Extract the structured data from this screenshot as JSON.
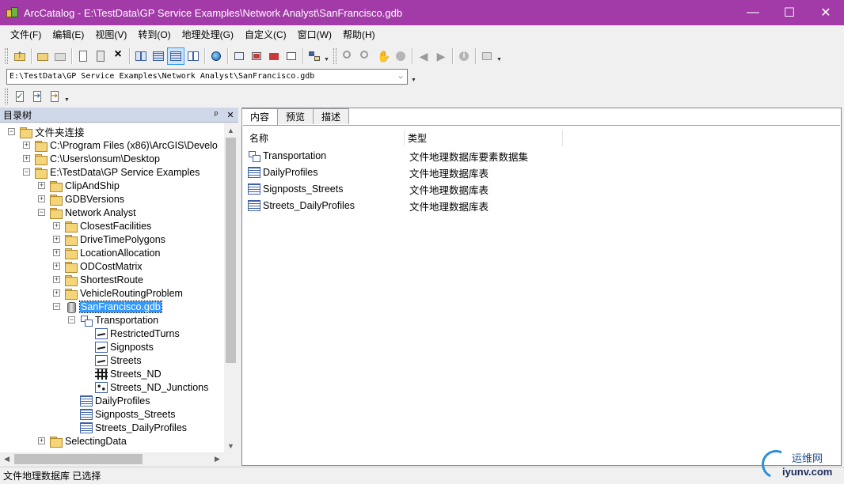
{
  "window": {
    "title": "ArcCatalog - E:\\TestData\\GP Service Examples\\Network Analyst\\SanFrancisco.gdb",
    "minimize": "—",
    "maximize": "☐",
    "close": "✕"
  },
  "menu": [
    "文件(F)",
    "编辑(E)",
    "视图(V)",
    "转到(O)",
    "地理处理(G)",
    "自定义(C)",
    "窗口(W)",
    "帮助(H)"
  ],
  "address": {
    "value": "E:\\TestData\\GP Service Examples\\Network Analyst\\SanFrancisco.gdb"
  },
  "tree_panel": {
    "title": "目录树",
    "pin": "ᵖ",
    "close": "✕",
    "nodes": [
      {
        "label": "文件夹连接",
        "icon": "folder",
        "expander": "−"
      },
      {
        "label": "C:\\Program Files (x86)\\ArcGIS\\Develo",
        "icon": "folder",
        "expander": "+"
      },
      {
        "label": "C:\\Users\\onsum\\Desktop",
        "icon": "folder",
        "expander": "+"
      },
      {
        "label": "E:\\TestData\\GP Service Examples",
        "icon": "folder",
        "expander": "−"
      },
      {
        "label": "ClipAndShip",
        "icon": "folder",
        "expander": "+"
      },
      {
        "label": "GDBVersions",
        "icon": "folder",
        "expander": "+"
      },
      {
        "label": "Network Analyst",
        "icon": "folder",
        "expander": "−"
      },
      {
        "label": "ClosestFacilities",
        "icon": "folder",
        "expander": "+"
      },
      {
        "label": "DriveTimePolygons",
        "icon": "folder",
        "expander": "+"
      },
      {
        "label": "LocationAllocation",
        "icon": "folder",
        "expander": "+"
      },
      {
        "label": "ODCostMatrix",
        "icon": "folder",
        "expander": "+"
      },
      {
        "label": "ShortestRoute",
        "icon": "folder",
        "expander": "+"
      },
      {
        "label": "VehicleRoutingProblem",
        "icon": "folder",
        "expander": "+"
      },
      {
        "label": "SanFrancisco.gdb",
        "icon": "gdb",
        "expander": "−"
      },
      {
        "label": "Transportation",
        "icon": "feature-dataset",
        "expander": "−"
      },
      {
        "label": "RestrictedTurns",
        "icon": "line-feature-class",
        "expander": ""
      },
      {
        "label": "Signposts",
        "icon": "line-feature-class",
        "expander": ""
      },
      {
        "label": "Streets",
        "icon": "line-feature-class",
        "expander": ""
      },
      {
        "label": "Streets_ND",
        "icon": "network-dataset",
        "expander": ""
      },
      {
        "label": "Streets_ND_Junctions",
        "icon": "point-feature-class",
        "expander": ""
      },
      {
        "label": "DailyProfiles",
        "icon": "table",
        "expander": ""
      },
      {
        "label": "Signposts_Streets",
        "icon": "table",
        "expander": ""
      },
      {
        "label": "Streets_DailyProfiles",
        "icon": "table",
        "expander": ""
      },
      {
        "label": "SelectingData",
        "icon": "folder",
        "expander": "+"
      }
    ]
  },
  "content": {
    "tabs": [
      "内容",
      "预览",
      "描述"
    ],
    "columns": [
      "名称",
      "类型"
    ],
    "rows": [
      {
        "name": "Transportation",
        "type": "文件地理数据库要素数据集",
        "icon": "feature-dataset"
      },
      {
        "name": "DailyProfiles",
        "type": "文件地理数据库表",
        "icon": "table"
      },
      {
        "name": "Signposts_Streets",
        "type": "文件地理数据库表",
        "icon": "table"
      },
      {
        "name": "Streets_DailyProfiles",
        "type": "文件地理数据库表",
        "icon": "table"
      }
    ]
  },
  "status": {
    "text": "文件地理数据库 已选择"
  },
  "watermark": {
    "cn": "运维网",
    "url": "iyunv.com"
  },
  "colors": {
    "titlebar": "#a23aa8",
    "selection": "#3399ff",
    "panel_header": "#cfd8e8"
  }
}
